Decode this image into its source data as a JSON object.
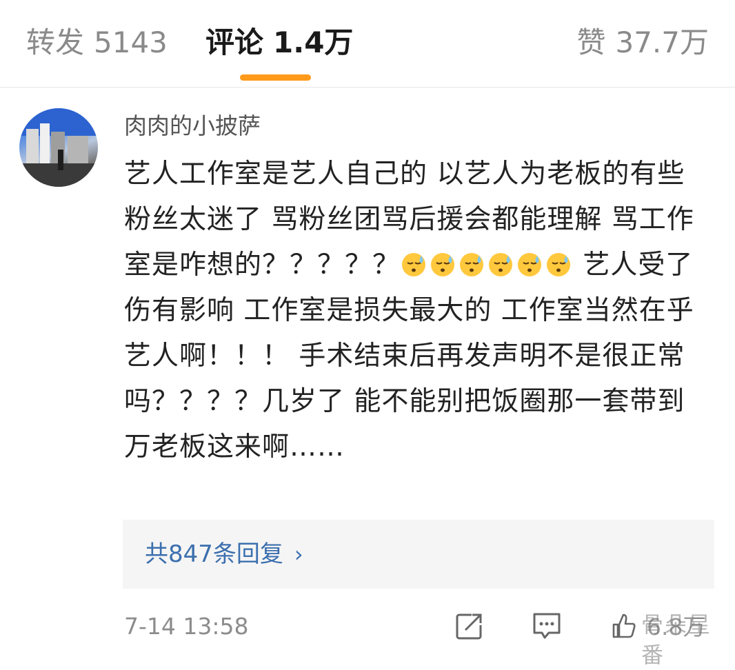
{
  "tabs": {
    "repost": {
      "label": "转发",
      "count": "5143"
    },
    "comments": {
      "label": "评论",
      "count": "1.4万"
    },
    "likes": {
      "label": "赞",
      "count": "37.7万"
    }
  },
  "comment": {
    "username": "肉肉的小披萨",
    "segments": {
      "s1": "艺人工作室是艺人自己的 以艺人为老板的有些粉丝太迷了 骂粉丝团骂后援会都能理解 骂工作室是咋想的？？？？？",
      "s2": " 艺人受了伤有影响 工作室是损失最大的 工作室当然在乎艺人啊！！！ 手术结束后再发声明不是很正常吗？？？？几岁了 能不能别把饭圈那一套带到万老板这来啊……"
    },
    "replies_label": "共847条回复",
    "timestamp": "7-14 13:58",
    "like_count": "6.8万",
    "watermark": "骨朵星番"
  },
  "icons": {
    "share": "share-icon",
    "comment": "comment-icon",
    "like": "like-icon",
    "emoji": "cold-sweat-emoji-icon"
  },
  "colors": {
    "accent": "#ff9a1a",
    "link": "#3b6fae"
  }
}
